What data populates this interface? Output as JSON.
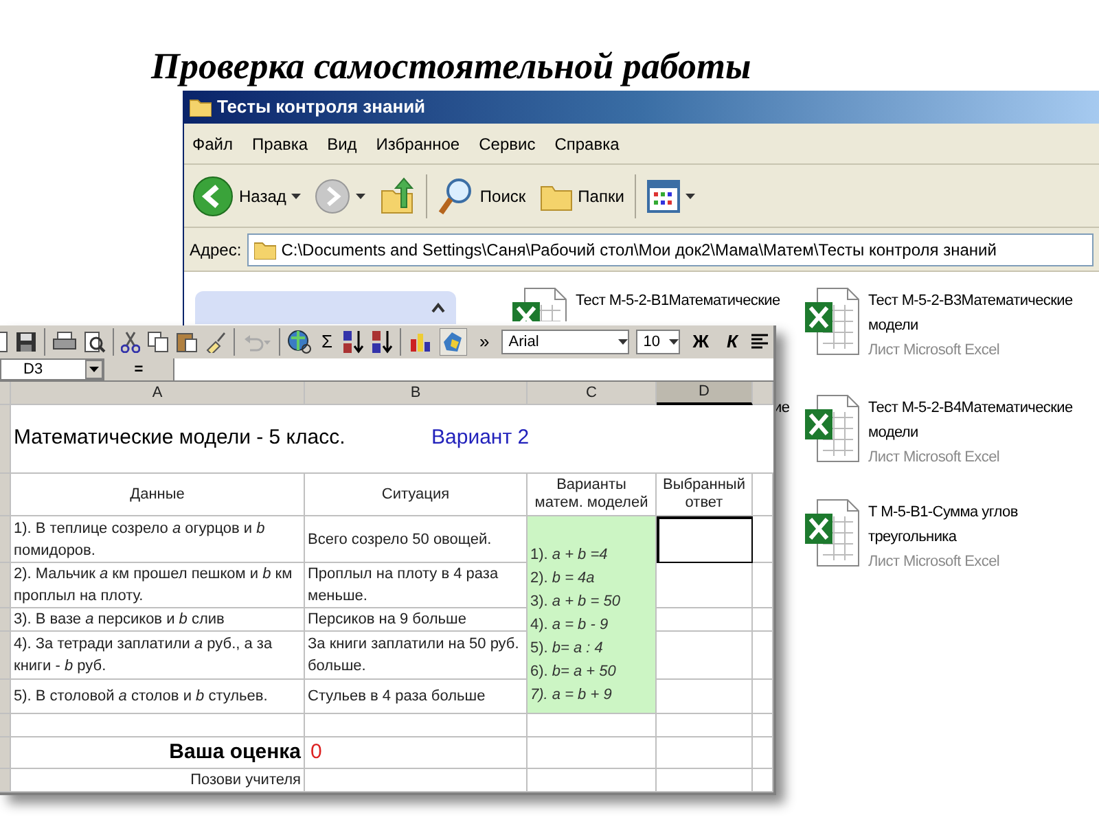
{
  "slide_title": "Проверка самостоятельной работы",
  "explorer": {
    "title": "Тесты контроля знаний",
    "menu": [
      "Файл",
      "Правка",
      "Вид",
      "Избранное",
      "Сервис",
      "Справка"
    ],
    "toolbar": [
      {
        "kind": "back",
        "label": "Назад"
      },
      {
        "kind": "forward"
      },
      {
        "kind": "up"
      },
      {
        "kind": "search",
        "label": "Поиск"
      },
      {
        "kind": "folders",
        "label": "Папки"
      },
      {
        "kind": "views"
      }
    ],
    "address": {
      "label": "Адрес:",
      "value": "C:\\Documents and Settings\\Саня\\Рабочий стол\\Мои док2\\Мама\\Матем\\Тесты контроля знаний"
    },
    "files": [
      {
        "name": [
          "Тест М-5-2-В1Математические"
        ]
      },
      {
        "name": [
          "ие"
        ]
      },
      {
        "name": [
          "Тест М-5-2-В3Математические",
          "модели"
        ],
        "type": "Лист Microsoft Excel"
      },
      {
        "name": [
          "Тест М-5-2-В4Математические",
          "модели"
        ],
        "type": "Лист Microsoft Excel"
      },
      {
        "name": [
          "Т М-5-В1-Сумма углов",
          "треугольника"
        ],
        "type": "Лист Microsoft Excel"
      }
    ]
  },
  "excel": {
    "toolbar": {
      "more": "»",
      "font": "Arial",
      "size": "10",
      "sigma": "Σ",
      "bold": "Ж",
      "italic": "К"
    },
    "name_box": "D3",
    "formula_sign": "=",
    "columns": [
      {
        "label": "A",
        "selected": false
      },
      {
        "label": "B",
        "selected": false
      },
      {
        "label": "C",
        "selected": false
      },
      {
        "label": "D",
        "selected": true
      }
    ],
    "title": "Математические модели - 5 класс.",
    "variant": "Вариант 2",
    "headers": [
      "Данные",
      "Ситуация",
      "Варианты матем. моделей",
      "Выбранный ответ"
    ],
    "rows": [
      {
        "data": "1). В теплице созрело *a* огурцов и *b* помидоров.",
        "situation": "Всего созрело 50 овощей.",
        "selected": true
      },
      {
        "data": "2). Мальчик *a* км прошел пешком и *b* км проплыл на плоту.",
        "situation": "Проплыл на плоту в 4 раза меньше.",
        "selected": false
      },
      {
        "data": "3). В вазе *a* персиков и *b* слив",
        "situation": "Персиков на 9 больше",
        "selected": false
      },
      {
        "data": "4). За тетради заплатили *a* руб., а за книги - *b* руб.",
        "situation": "За книги заплатили на 50 руб. больше.",
        "selected": false
      },
      {
        "data": "5). В столовой *a* столов и *b* стульев.",
        "situation": "Стульев в 4 раза больше",
        "selected": false
      }
    ],
    "models": [
      "1).  *a + b =4*",
      "2).  *b = 4a*",
      "3). *a + b = 50*",
      "4).  *a = b - 9*",
      "5).  *b= a : 4*",
      "6).   *b= a + 50*",
      "*7). a = b + 9*"
    ],
    "score_label": "Ваша оценка",
    "score": "0",
    "call_teacher": "Позови учителя"
  }
}
